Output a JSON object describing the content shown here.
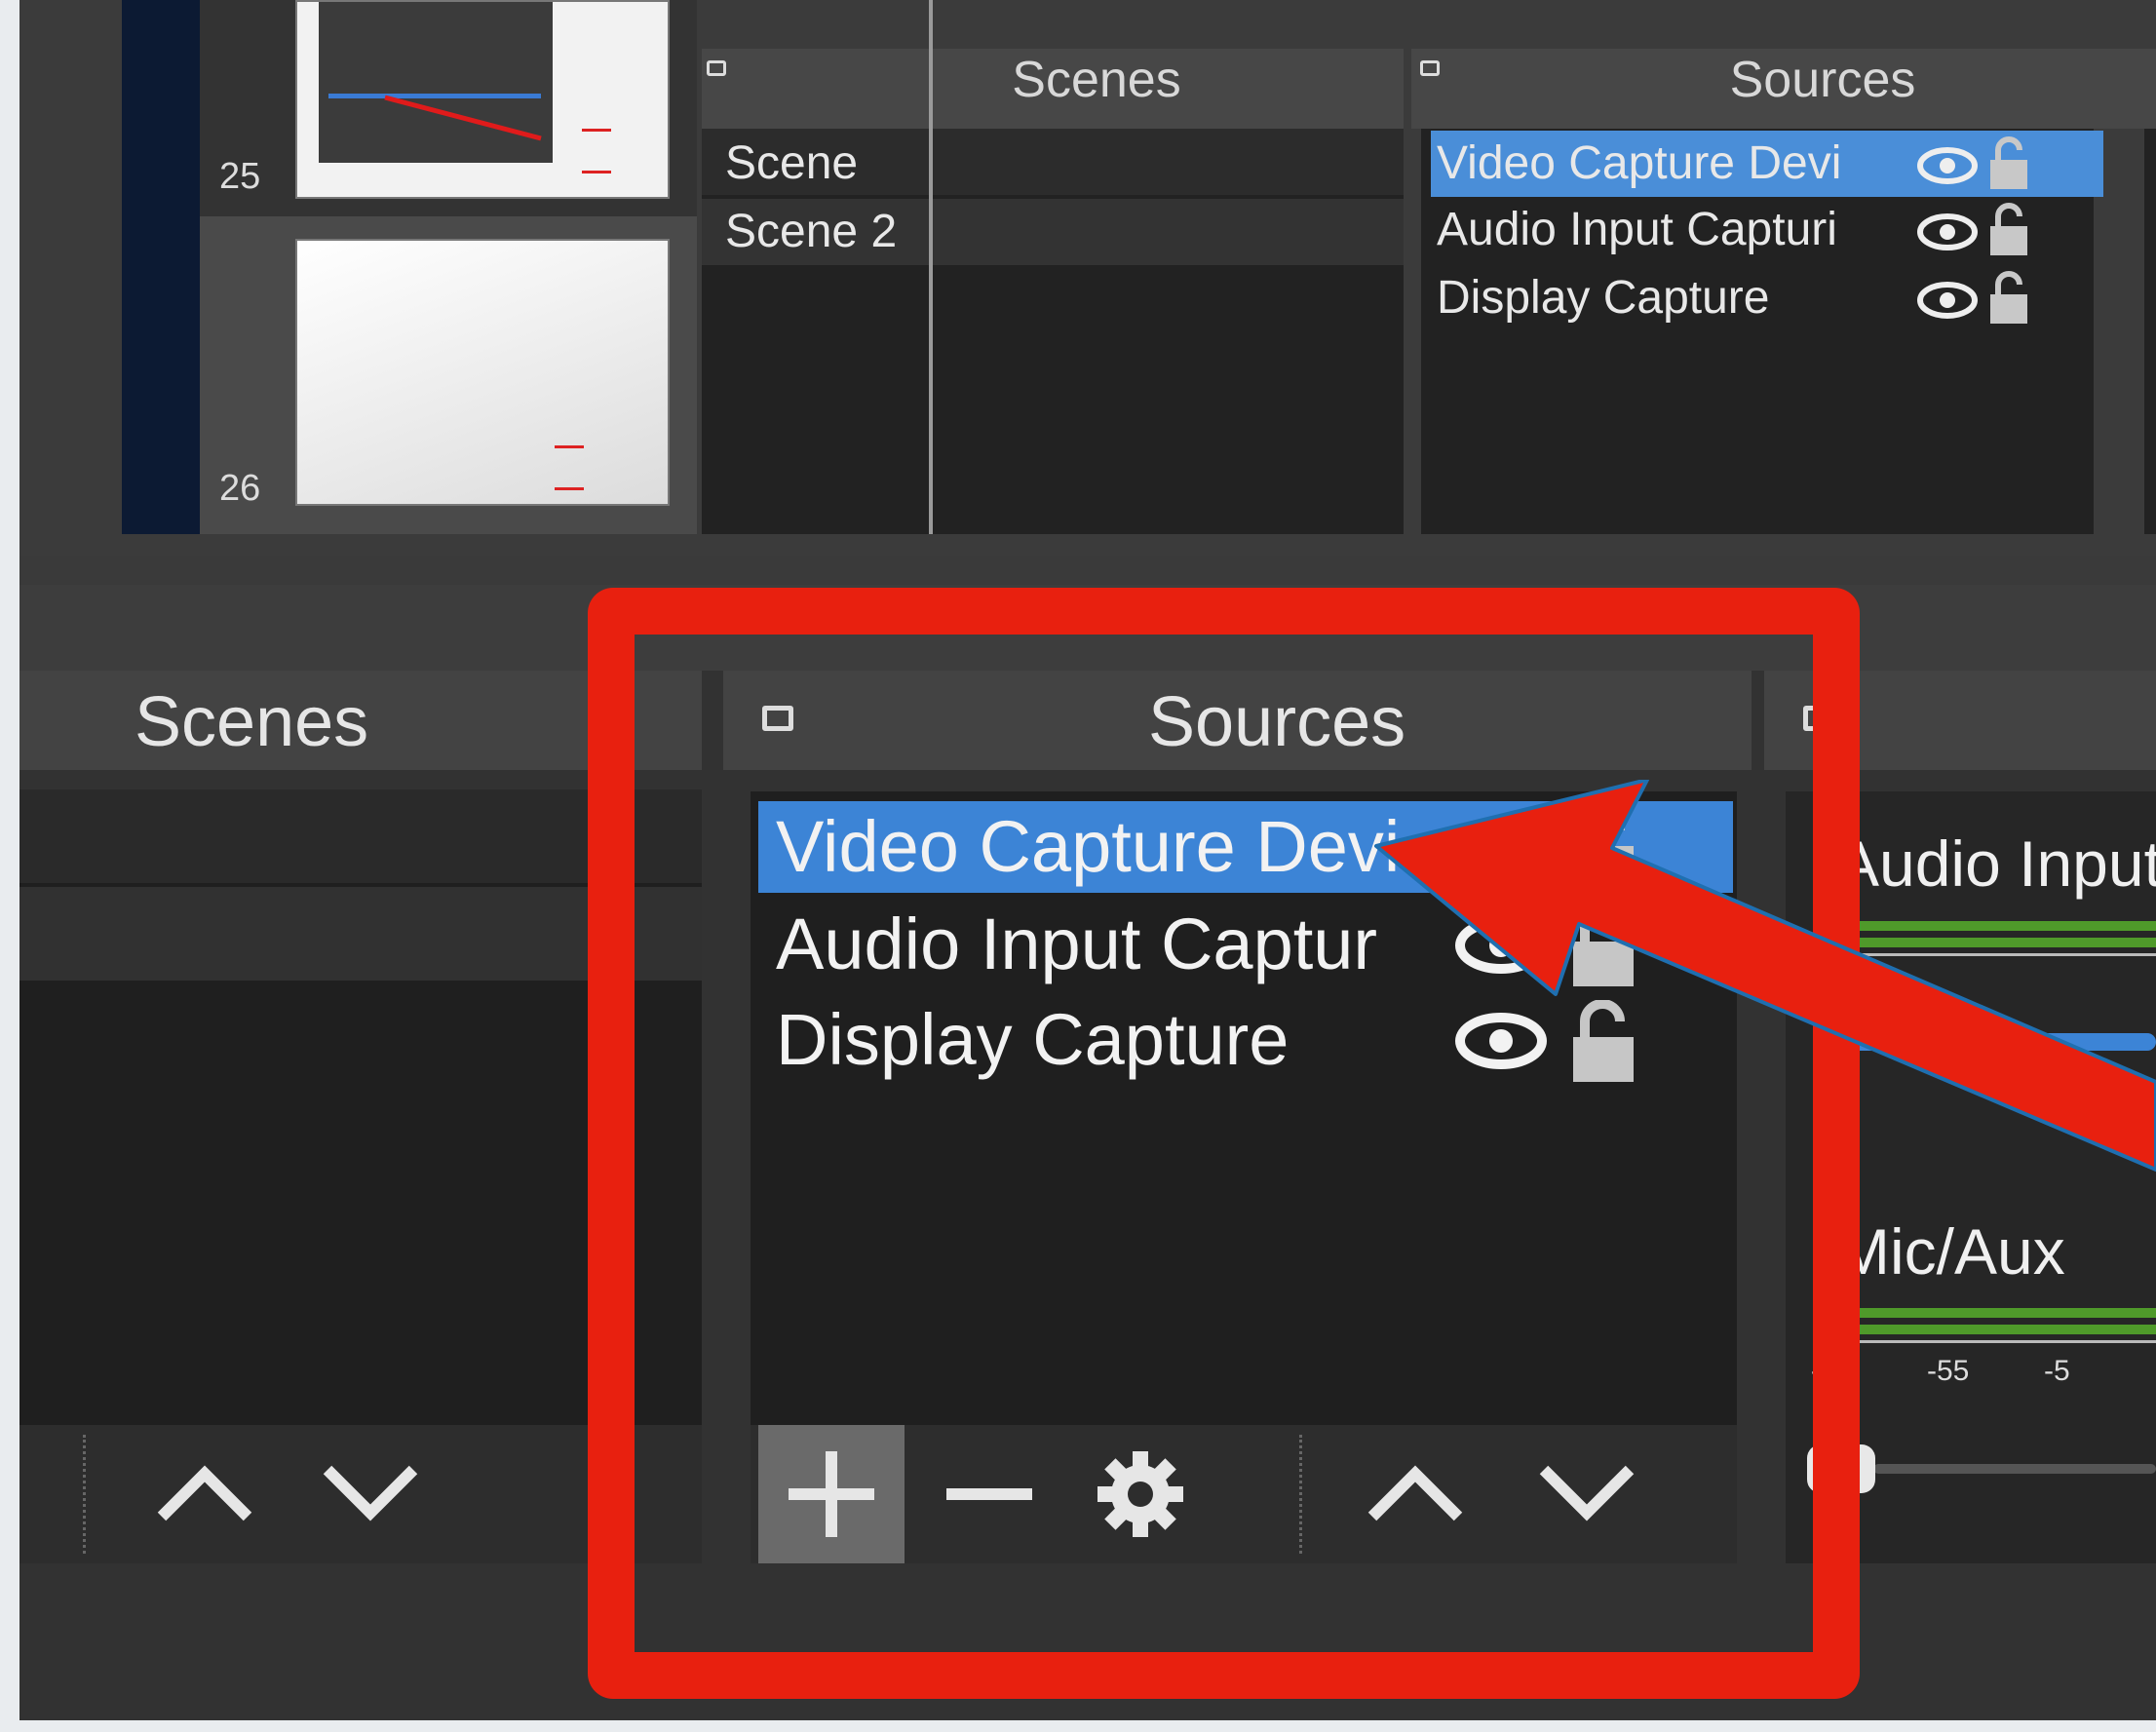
{
  "top": {
    "slides": [
      {
        "number": "25"
      },
      {
        "number": "26"
      }
    ],
    "scenes_dock": {
      "title": "Scenes",
      "items": [
        "Scene",
        "Scene 2"
      ]
    },
    "sources_dock": {
      "title": "Sources",
      "items": [
        {
          "label": "Video Capture Devi",
          "selected": true
        },
        {
          "label": "Audio Input Capturi",
          "selected": false
        },
        {
          "label": "Display Capture",
          "selected": false
        }
      ]
    }
  },
  "bottom": {
    "scenes_dock": {
      "title": "Scenes"
    },
    "sources_dock": {
      "title": "Sources",
      "items": [
        {
          "label": "Video Capture Devi",
          "selected": true
        },
        {
          "label": "Audio Input Captur",
          "selected": false
        },
        {
          "label": "Display Capture",
          "selected": false
        }
      ]
    },
    "mixer": {
      "channels": [
        {
          "label": "Audio Input",
          "meter_scale": []
        },
        {
          "label": "Mic/Aux",
          "meter_scale": [
            "-60",
            "-55",
            "-5"
          ]
        }
      ]
    }
  },
  "colors": {
    "highlight": "#e8200f",
    "selection": "#3c84d6",
    "meter_green": "#4f9a2a"
  },
  "icons": [
    "float-icon",
    "eye-icon",
    "lock-icon",
    "plus-icon",
    "minus-icon",
    "gear-icon",
    "chevron-up-icon",
    "chevron-down-icon"
  ]
}
